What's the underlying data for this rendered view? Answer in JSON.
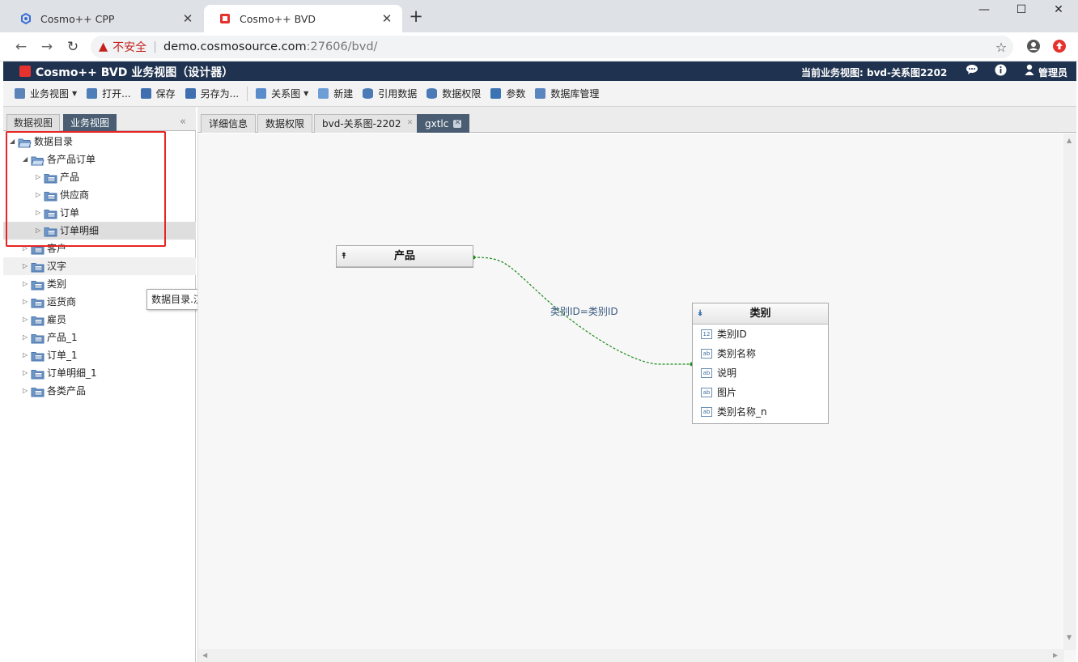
{
  "browser": {
    "tabs": [
      {
        "title": "Cosmo++ CPP",
        "active": false
      },
      {
        "title": "Cosmo++ BVD",
        "active": true
      }
    ],
    "address": {
      "security_label": "不安全",
      "host": "demo.cosmosource.com",
      "rest": ":27606/bvd/"
    }
  },
  "app": {
    "title": "Cosmo++ BVD 业务视图（设计器）",
    "current_view": "当前业务视图: bvd-关系图2202",
    "user": "管理员",
    "header_color": "#1f3250",
    "accent_red": "#e5322d"
  },
  "toolbar": [
    {
      "label": "业务视图",
      "icon": "page-icon",
      "dropdown": true
    },
    {
      "label": "打开...",
      "icon": "open-folder-icon",
      "dropdown": false
    },
    {
      "label": "保存",
      "icon": "save-icon",
      "dropdown": false
    },
    {
      "label": "另存为...",
      "icon": "save-as-icon",
      "dropdown": false
    },
    {
      "label": "关系图",
      "icon": "diagram-icon",
      "dropdown": true
    },
    {
      "label": "新建",
      "icon": "new-icon",
      "dropdown": false
    },
    {
      "label": "引用数据",
      "icon": "database-icon",
      "dropdown": false
    },
    {
      "label": "数据权限",
      "icon": "database-permission-icon",
      "dropdown": false
    },
    {
      "label": "参数",
      "icon": "params-icon",
      "dropdown": false
    },
    {
      "label": "数据库管理",
      "icon": "db-manage-icon",
      "dropdown": false
    }
  ],
  "left_tabs": [
    {
      "label": "数据视图",
      "active": false
    },
    {
      "label": "业务视图",
      "active": true
    }
  ],
  "tree": [
    {
      "label": "数据目录",
      "level": 0,
      "expanded": true,
      "folder": "open"
    },
    {
      "label": "各产品订单",
      "level": 1,
      "expanded": true,
      "folder": "open"
    },
    {
      "label": "产品",
      "level": 2,
      "expanded": false,
      "folder": "table"
    },
    {
      "label": "供应商",
      "level": 2,
      "expanded": false,
      "folder": "table"
    },
    {
      "label": "订单",
      "level": 2,
      "expanded": false,
      "folder": "table"
    },
    {
      "label": "订单明细",
      "level": 2,
      "expanded": false,
      "folder": "table",
      "selected": true
    },
    {
      "label": "客户",
      "level": 1,
      "expanded": false,
      "folder": "table"
    },
    {
      "label": "汉字",
      "level": 1,
      "expanded": false,
      "folder": "table",
      "hover": true
    },
    {
      "label": "类别",
      "level": 1,
      "expanded": false,
      "folder": "table"
    },
    {
      "label": "运货商",
      "level": 1,
      "expanded": false,
      "folder": "table"
    },
    {
      "label": "雇员",
      "level": 1,
      "expanded": false,
      "folder": "table"
    },
    {
      "label": "产品_1",
      "level": 1,
      "expanded": false,
      "folder": "table"
    },
    {
      "label": "订单_1",
      "level": 1,
      "expanded": false,
      "folder": "table"
    },
    {
      "label": "订单明细_1",
      "level": 1,
      "expanded": false,
      "folder": "table"
    },
    {
      "label": "各类产品",
      "level": 1,
      "expanded": false,
      "folder": "table"
    }
  ],
  "tooltip": "数据目录.汉字",
  "doc_tabs": [
    {
      "label": "详细信息",
      "closable": false,
      "active": false
    },
    {
      "label": "数据权限",
      "closable": false,
      "active": false
    },
    {
      "label": "bvd-关系图-2202",
      "closable": true,
      "active": false
    },
    {
      "label": "gxtlc",
      "closable": true,
      "active": true
    }
  ],
  "diagram": {
    "entity_product": {
      "title": "产品",
      "collapsed": true
    },
    "entity_category": {
      "title": "类别",
      "collapsed": false,
      "fields": [
        {
          "name": "类别ID",
          "type": "12"
        },
        {
          "name": "类别名称",
          "type": "ab"
        },
        {
          "name": "说明",
          "type": "ab"
        },
        {
          "name": "图片",
          "type": "ab"
        },
        {
          "name": "类别名称_n",
          "type": "ab"
        }
      ]
    },
    "relation_label": "类别ID=类别ID",
    "relation_color": "#1a8a1a"
  }
}
